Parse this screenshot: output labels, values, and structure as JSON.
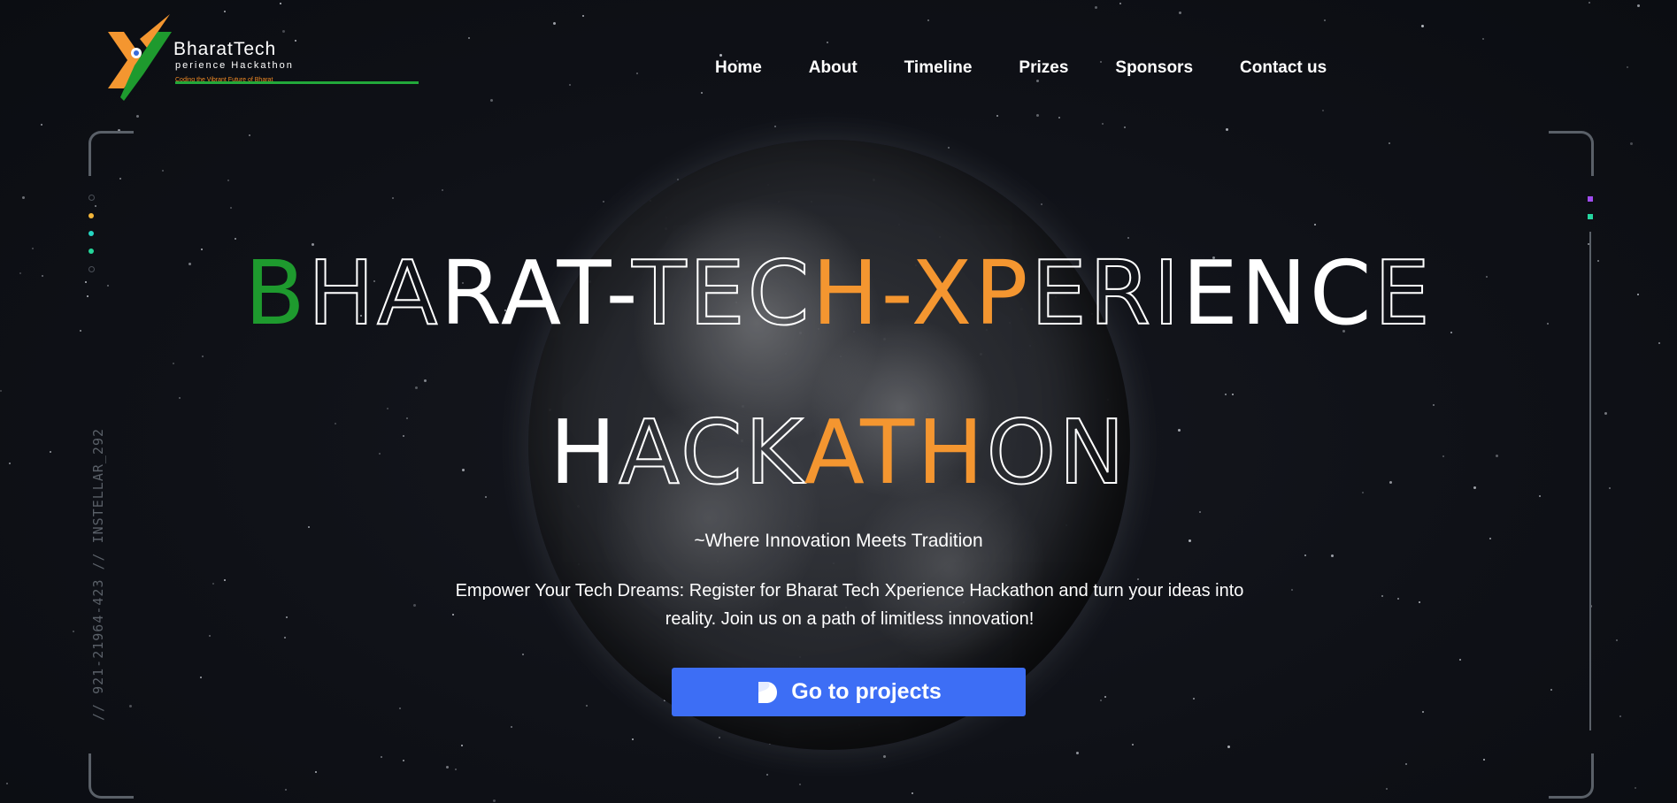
{
  "logo": {
    "title": "BharatTech",
    "subtitle": "perience Hackathon",
    "tagline": "Coding the Vibrant Future of Bharat",
    "colors": {
      "orange": "#f49630",
      "green": "#1e9a2e"
    }
  },
  "nav": {
    "items": [
      {
        "label": "Home"
      },
      {
        "label": "About"
      },
      {
        "label": "Timeline"
      },
      {
        "label": "Prizes"
      },
      {
        "label": "Sponsors"
      },
      {
        "label": "Contact us"
      }
    ]
  },
  "hero": {
    "headline_line1": "BHARAT-TECH-XPERIENCE",
    "headline_line2": "HACKATHON",
    "tagline": "~Where Innovation Meets Tradition",
    "description": "Empower Your Tech Dreams: Register for Bharat Tech Xperience Hackathon and turn your ideas into reality. Join us on a path of limitless innovation!",
    "cta_label": "Go to projects",
    "cta_icon": "d-shape-icon",
    "cta_color": "#3d6ef5"
  },
  "side": {
    "code_text": "// 921-21964-423 // INSTELLAR_292"
  },
  "decor": {
    "left_dots": [
      "#4a4f57",
      "#f4b63a",
      "#25d6c2",
      "#25d69a",
      "#4a4f57"
    ],
    "right_squares": [
      "#a04cf0",
      "#25d6a0"
    ]
  }
}
